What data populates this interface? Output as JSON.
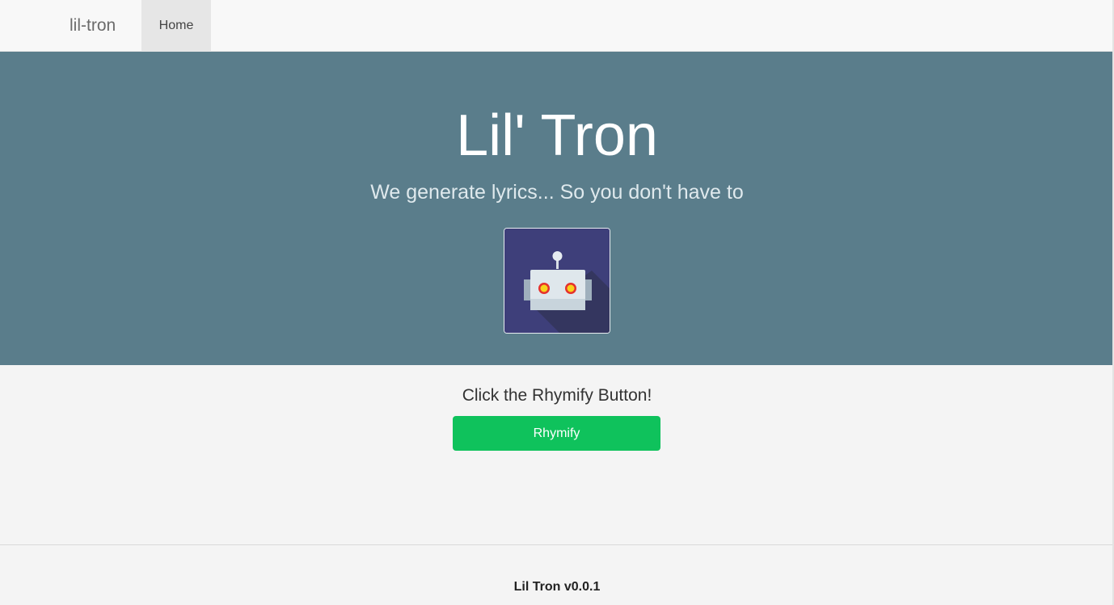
{
  "nav": {
    "brand": "lil-tron",
    "tabs": [
      {
        "label": "Home",
        "active": true
      }
    ]
  },
  "hero": {
    "title": "Lil' Tron",
    "subtitle": "We generate lyrics... So you don't have to",
    "logo_icon": "robot-icon"
  },
  "main": {
    "prompt": "Click the Rhymify Button!",
    "button_label": "Rhymify"
  },
  "footer": {
    "text": "Lil Tron v0.0.1"
  },
  "colors": {
    "hero_bg": "#5a7d8b",
    "button_bg": "#0fc25c",
    "robot_bg": "#3e3f7a",
    "page_bg": "#f4f4f4"
  }
}
